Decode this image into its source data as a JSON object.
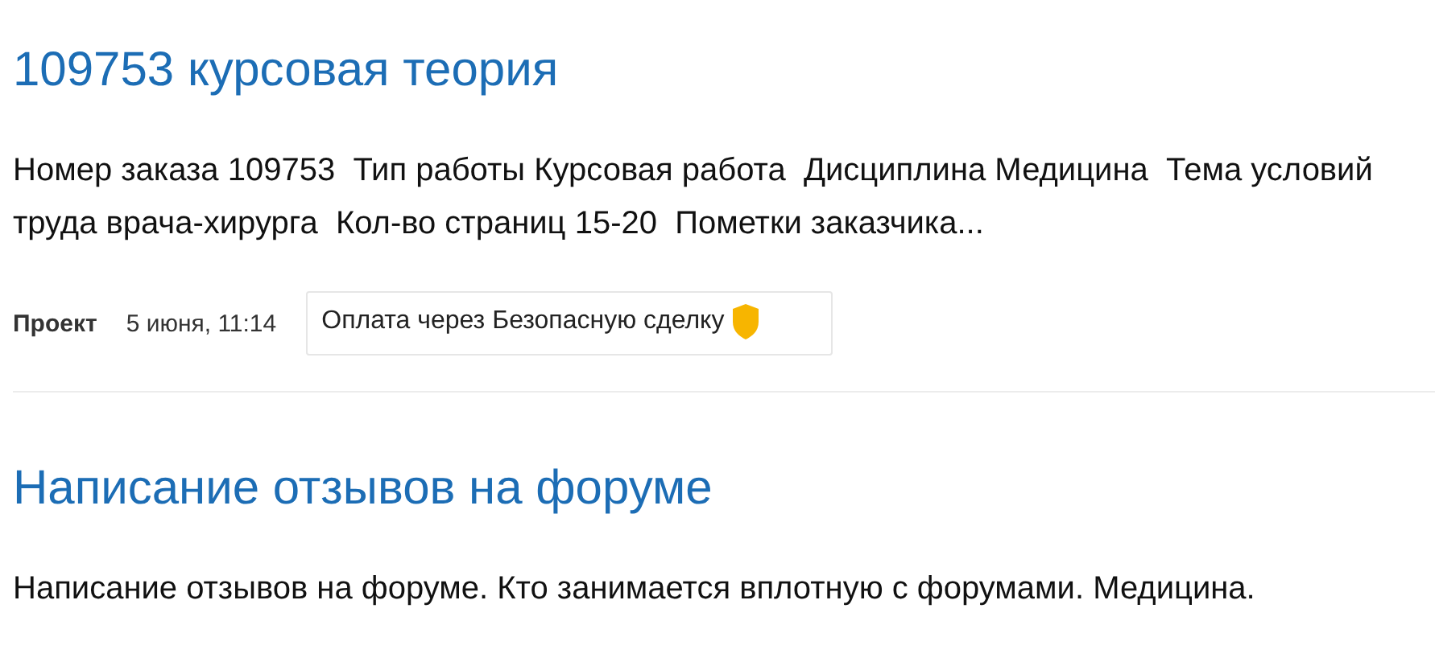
{
  "orders": [
    {
      "title": "109753 курсовая теория",
      "description": "Номер заказа 109753  Тип работы Курсовая работа  Дисциплина Медицина  Тема условий труда врача-хирурга  Кол-во страниц 15-20  Пометки заказчика...",
      "meta": {
        "type": "Проект",
        "date": "5 июня, 11:14",
        "payment": "Оплата через Безопасную сделку"
      }
    },
    {
      "title": "Написание отзывов на форуме",
      "description": "Написание отзывов на форуме. Кто занимается вплотную с форумами. Медицина."
    }
  ]
}
